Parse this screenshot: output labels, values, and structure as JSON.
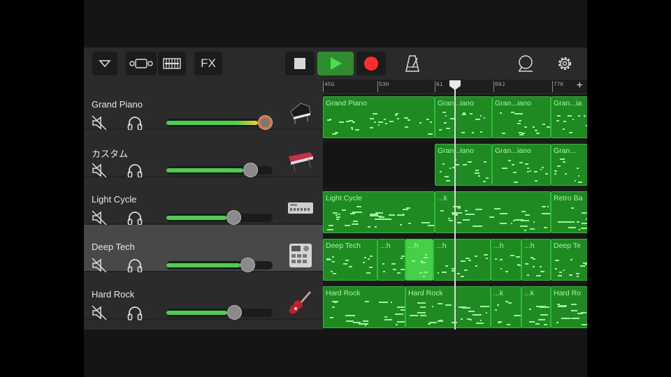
{
  "toolbar": {
    "fx_label": "FX",
    "accent_green": "#3aa63a",
    "record_color": "#ff2d2d"
  },
  "tracks": [
    {
      "name": "Grand Piano",
      "volume": 0.93,
      "instrument": "grand-piano"
    },
    {
      "name": "カスタム",
      "volume": 0.79,
      "instrument": "keyboard-synth"
    },
    {
      "name": "Light Cycle",
      "volume": 0.63,
      "instrument": "drum-machine"
    },
    {
      "name": "Deep Tech",
      "volume": 0.76,
      "instrument": "beat-sequencer",
      "selected": true
    },
    {
      "name": "Hard Rock",
      "volume": 0.64,
      "instrument": "electric-guitar"
    }
  ],
  "ruler": {
    "labels": [
      "45G",
      "53H",
      "61",
      "69J",
      "77K"
    ],
    "add_label": "+"
  },
  "regions": [
    [
      {
        "label": "Grand Piano"
      },
      {
        "label": "Gran...iano"
      },
      {
        "label": "Gran...iano"
      },
      {
        "label": "Gran...ia"
      }
    ],
    [
      {
        "label": "Gran...iano"
      },
      {
        "label": "Gran...iano"
      },
      {
        "label": "Gran..."
      }
    ],
    [
      {
        "label": "Light Cycle"
      },
      {
        "label": "...k"
      },
      {
        "label": "Retro Ba"
      }
    ],
    [
      {
        "label": "Deep Tech"
      },
      {
        "label": "...h"
      },
      {
        "label": "...h"
      },
      {
        "label": "...h"
      },
      {
        "label": "...h"
      },
      {
        "label": "...h"
      },
      {
        "label": "Deep Te"
      }
    ],
    [
      {
        "label": "Hard Rock"
      },
      {
        "label": "Hard Rock"
      },
      {
        "label": "...k"
      },
      {
        "label": "...k"
      },
      {
        "label": "Hard Ro"
      }
    ]
  ]
}
